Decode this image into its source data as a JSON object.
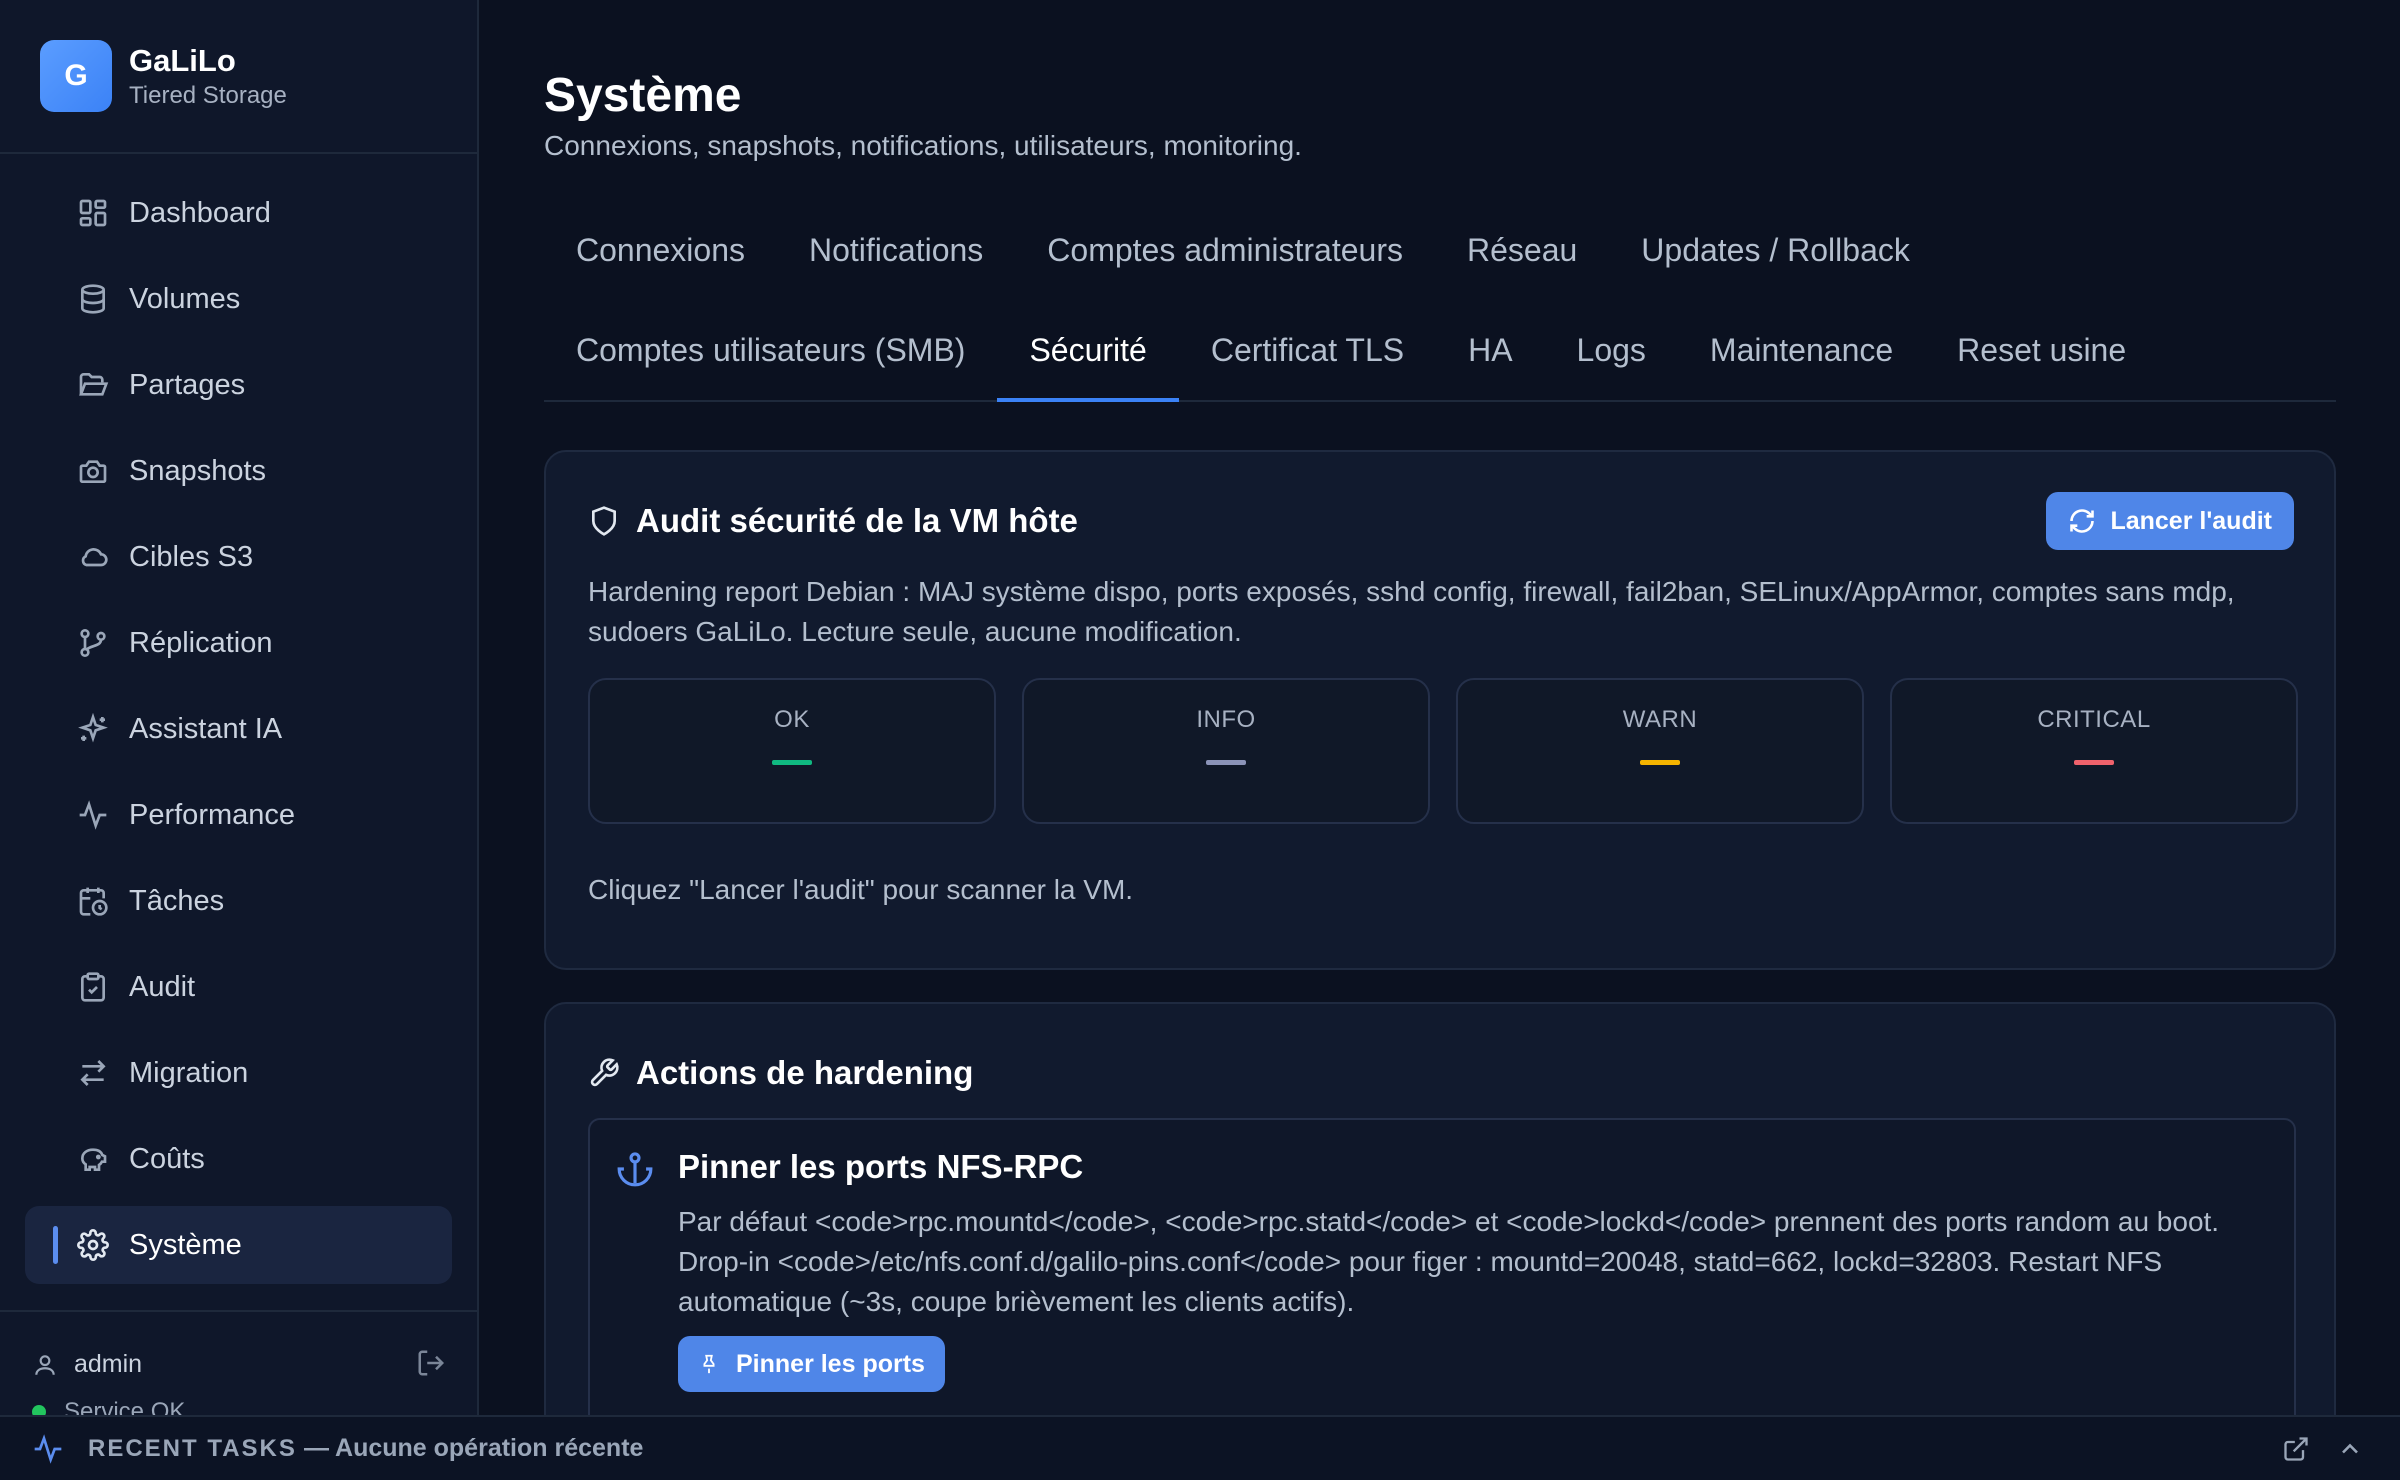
{
  "brand": {
    "logo_letter": "G",
    "name": "GaLiLo",
    "subtitle": "Tiered Storage"
  },
  "sidebar": {
    "items": [
      {
        "label": "Dashboard",
        "icon": "dashboard-icon"
      },
      {
        "label": "Volumes",
        "icon": "database-icon"
      },
      {
        "label": "Partages",
        "icon": "folder-open-icon"
      },
      {
        "label": "Snapshots",
        "icon": "camera-icon"
      },
      {
        "label": "Cibles S3",
        "icon": "cloud-icon"
      },
      {
        "label": "Réplication",
        "icon": "git-branch-icon"
      },
      {
        "label": "Assistant IA",
        "icon": "sparkles-icon"
      },
      {
        "label": "Performance",
        "icon": "activity-icon"
      },
      {
        "label": "Tâches",
        "icon": "calendar-clock-icon"
      },
      {
        "label": "Audit",
        "icon": "clipboard-check-icon"
      },
      {
        "label": "Migration",
        "icon": "arrows-swap-icon"
      },
      {
        "label": "Coûts",
        "icon": "piggy-bank-icon"
      },
      {
        "label": "Système",
        "icon": "gear-icon",
        "active": true
      }
    ],
    "user": "admin",
    "service_status": "Service OK"
  },
  "page": {
    "title": "Système",
    "subtitle": "Connexions, snapshots, notifications, utilisateurs, monitoring."
  },
  "tabs": {
    "row1": [
      "Connexions",
      "Notifications",
      "Comptes administrateurs",
      "Réseau",
      "Updates / Rollback"
    ],
    "row2": [
      "Comptes utilisateurs (SMB)",
      "Sécurité",
      "Certificat TLS",
      "HA",
      "Logs",
      "Maintenance",
      "Reset usine"
    ],
    "active": "Sécurité"
  },
  "audit": {
    "title": "Audit sécurité de la VM hôte",
    "button": "Lancer l'audit",
    "description": "Hardening report Debian : MAJ système dispo, ports exposés, sshd config, firewall, fail2ban, SELinux/AppArmor, comptes sans mdp, sudoers GaLiLo. Lecture seule, aucune modification.",
    "stats": [
      {
        "label": "OK",
        "color": "#10b981"
      },
      {
        "label": "INFO",
        "color": "#8b93b8"
      },
      {
        "label": "WARN",
        "color": "#f5b400"
      },
      {
        "label": "CRITICAL",
        "color": "#f0626c"
      }
    ],
    "hint": "Cliquez \"Lancer l'audit\" pour scanner la VM."
  },
  "hardening": {
    "title": "Actions de hardening",
    "action": {
      "title": "Pinner les ports NFS-RPC",
      "description": "Par défaut <code>rpc.mountd</code>, <code>rpc.statd</code> et <code>lockd</code> prennent des ports random au boot. Drop-in <code>/etc/nfs.conf.d/galilo-pins.conf</code> pour figer : mountd=20048, statd=662, lockd=32803. Restart NFS automatique (~3s, coupe brièvement les clients actifs).",
      "button": "Pinner les ports"
    }
  },
  "bottombar": {
    "label": "RECENT TASKS",
    "status": "— Aucune opération récente"
  },
  "colors": {
    "accent": "#4f86e8",
    "background": "#0b1120",
    "sidebar": "#0f172a",
    "card": "#111a2e"
  }
}
